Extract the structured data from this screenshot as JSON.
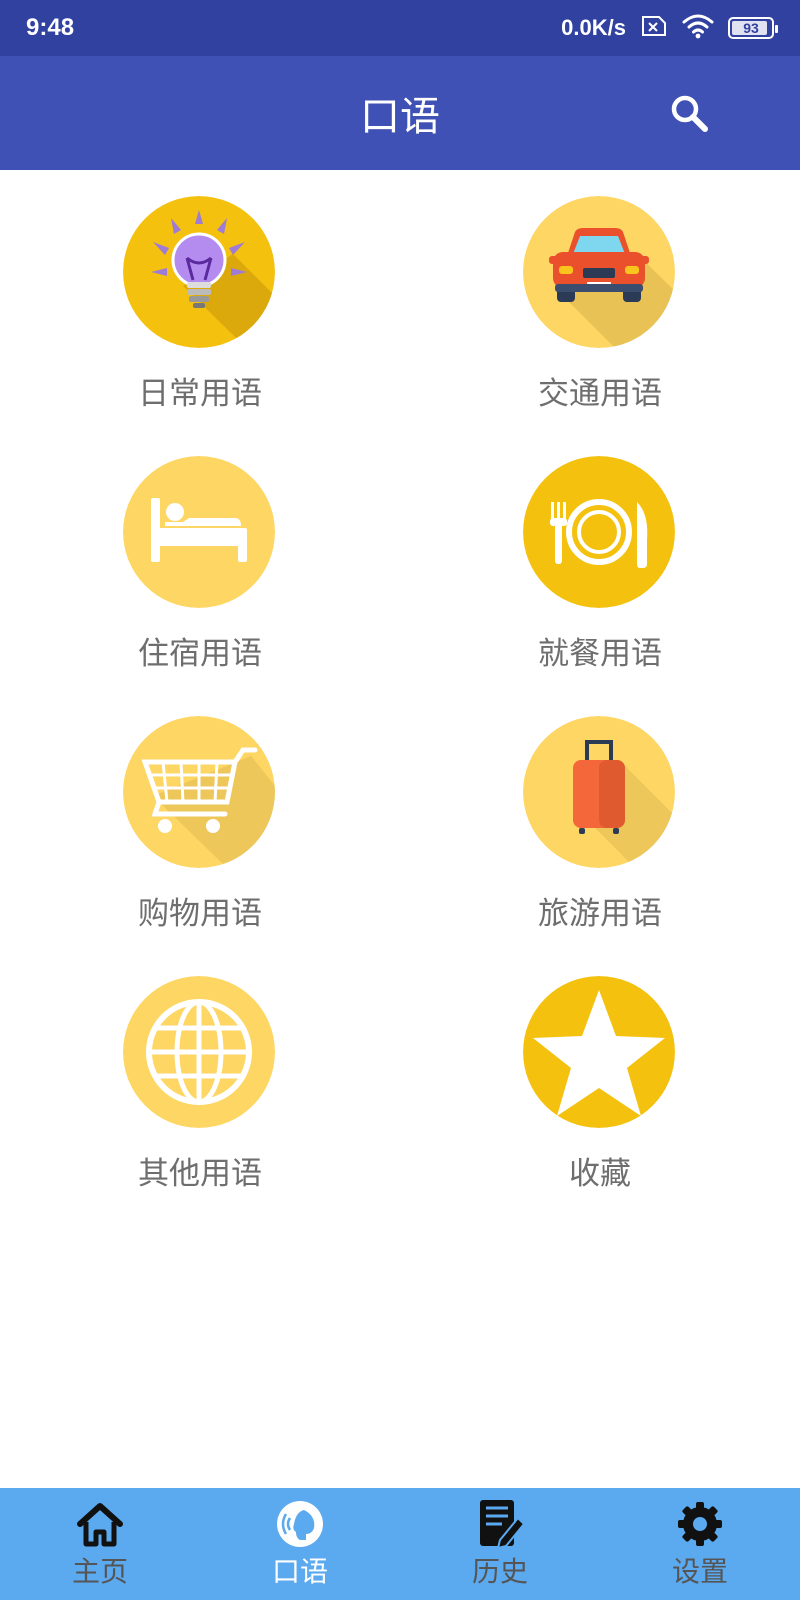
{
  "status_bar": {
    "time": "9:48",
    "net_speed": "0.0K/s",
    "battery_level": "93",
    "icons": [
      "sim-no-service-icon",
      "wifi-icon",
      "battery-icon"
    ]
  },
  "app_bar": {
    "title": "口语",
    "search_icon": "search-icon"
  },
  "categories": [
    {
      "label": "日常用语",
      "icon": "lightbulb-icon"
    },
    {
      "label": "交通用语",
      "icon": "car-icon"
    },
    {
      "label": "住宿用语",
      "icon": "bed-icon"
    },
    {
      "label": "就餐用语",
      "icon": "dining-icon"
    },
    {
      "label": "购物用语",
      "icon": "shopping-cart-icon"
    },
    {
      "label": "旅游用语",
      "icon": "suitcase-icon"
    },
    {
      "label": "其他用语",
      "icon": "globe-icon"
    },
    {
      "label": "收藏",
      "icon": "star-icon"
    }
  ],
  "bottom_nav": {
    "active_index": 1,
    "items": [
      {
        "label": "主页",
        "icon": "home-icon"
      },
      {
        "label": "口语",
        "icon": "speech-icon"
      },
      {
        "label": "历史",
        "icon": "history-icon"
      },
      {
        "label": "设置",
        "icon": "gear-icon"
      }
    ]
  },
  "colors": {
    "status_bar": "#3041A0",
    "app_bar": "#3F51B5",
    "bottom_nav": "#5BA9EE",
    "circle_light": "#FDD663",
    "circle_dark": "#F4C10F",
    "label_text": "#6E6E6E"
  }
}
